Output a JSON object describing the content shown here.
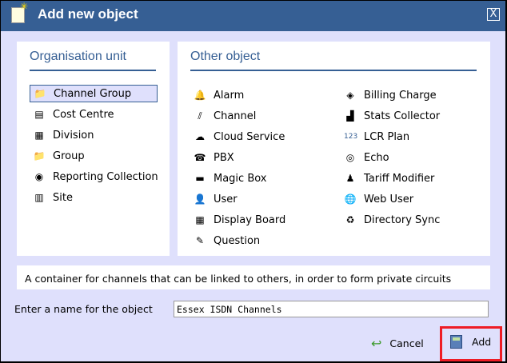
{
  "title": "Add new object",
  "org": {
    "heading": "Organisation unit",
    "items": [
      {
        "label": "Channel Group",
        "icon": "folder-chart-icon",
        "glyph": "📁"
      },
      {
        "label": "Cost Centre",
        "icon": "cost-centre-icon",
        "glyph": "▤"
      },
      {
        "label": "Division",
        "icon": "division-icon",
        "glyph": "▦"
      },
      {
        "label": "Group",
        "icon": "folder-icon",
        "glyph": "📁"
      },
      {
        "label": "Reporting Collection",
        "icon": "reporting-collection-icon",
        "glyph": "◉"
      },
      {
        "label": "Site",
        "icon": "building-icon",
        "glyph": "▥"
      }
    ]
  },
  "other": {
    "heading": "Other object",
    "col1": [
      {
        "label": "Alarm",
        "icon": "alarm-bell-icon",
        "glyph": "🔔"
      },
      {
        "label": "Channel",
        "icon": "channel-icon",
        "glyph": "⫽"
      },
      {
        "label": "Cloud Service",
        "icon": "cloud-icon",
        "glyph": "☁"
      },
      {
        "label": "PBX",
        "icon": "pbx-icon",
        "glyph": "☎"
      },
      {
        "label": "Magic Box",
        "icon": "magic-box-icon",
        "glyph": "▬"
      },
      {
        "label": "User",
        "icon": "user-icon",
        "glyph": "👤"
      },
      {
        "label": "Display Board",
        "icon": "display-board-icon",
        "glyph": "▦"
      },
      {
        "label": "Question",
        "icon": "question-icon",
        "glyph": "✎"
      }
    ],
    "col2": [
      {
        "label": "Billing Charge",
        "icon": "billing-charge-icon",
        "glyph": "◈"
      },
      {
        "label": "Stats Collector",
        "icon": "stats-collector-icon",
        "glyph": "▟"
      },
      {
        "label": "LCR Plan",
        "icon": "lcr-plan-icon",
        "glyph": "123"
      },
      {
        "label": "Echo",
        "icon": "echo-icon",
        "glyph": "◎"
      },
      {
        "label": "Tariff Modifier",
        "icon": "tariff-modifier-icon",
        "glyph": "♟"
      },
      {
        "label": "Web User",
        "icon": "globe-icon",
        "glyph": "🌐"
      },
      {
        "label": "Directory Sync",
        "icon": "sync-icon",
        "glyph": "♻"
      }
    ]
  },
  "description": "A container for channels that can be linked to others, in order to form private circuits",
  "name_label": "Enter a name for the object",
  "name_value": "Essex ISDN Channels",
  "cancel": "Cancel",
  "add": "Add",
  "close": "X"
}
